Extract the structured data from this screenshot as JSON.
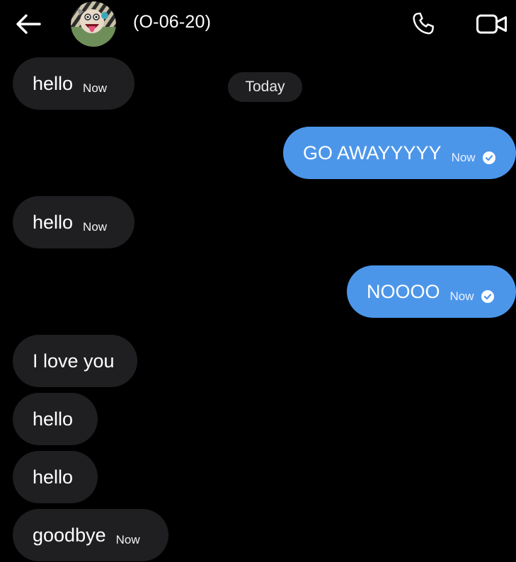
{
  "header": {
    "contact_name": "(O-06-20)",
    "back_icon": "arrow-left-icon",
    "call_icon": "phone-icon",
    "video_icon": "video-camera-icon"
  },
  "date_separator": "Today",
  "messages": [
    {
      "direction": "in",
      "text": "hello",
      "time": "Now"
    },
    {
      "direction": "out",
      "text": "GO AWAYYYYY",
      "time": "Now",
      "read": true
    },
    {
      "direction": "in",
      "text": "hello",
      "time": "Now"
    },
    {
      "direction": "out",
      "text": "NOOOO",
      "time": "Now",
      "read": true
    },
    {
      "direction": "in",
      "text": "I love you"
    },
    {
      "direction": "in",
      "text": "hello"
    },
    {
      "direction": "in",
      "text": "hello"
    },
    {
      "direction": "in",
      "text": "goodbye",
      "time": "Now"
    }
  ],
  "colors": {
    "background": "#000000",
    "incoming_bubble": "#1f1f21",
    "outgoing_bubble": "#4c96ea",
    "text": "#ffffff"
  }
}
